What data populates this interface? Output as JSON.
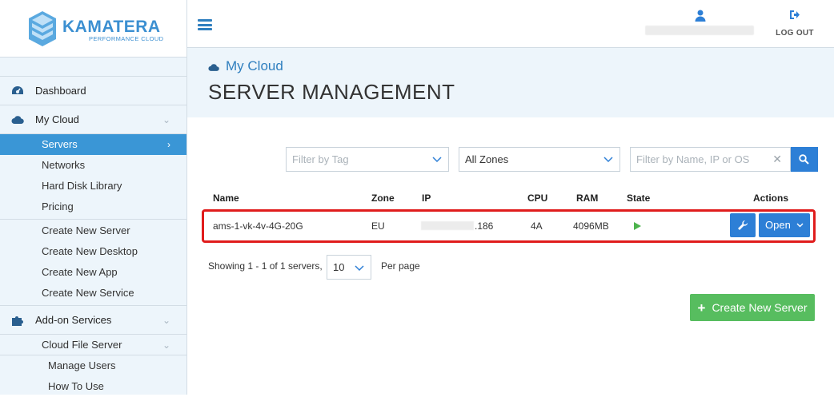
{
  "brand": {
    "name": "KAMATERA",
    "tagline": "PERFORMANCE CLOUD",
    "color": "#3b8fd1"
  },
  "sidebar": {
    "dashboard": "Dashboard",
    "my_cloud": "My Cloud",
    "my_cloud_items": [
      "Servers",
      "Networks",
      "Hard Disk Library",
      "Pricing"
    ],
    "create_items": [
      "Create New Server",
      "Create New Desktop",
      "Create New App",
      "Create New Service"
    ],
    "addon": "Add-on Services",
    "cloud_file_server": "Cloud File Server",
    "cfs_items": [
      "Manage Users",
      "How To Use"
    ]
  },
  "topbar": {
    "logout": "LOG OUT"
  },
  "header": {
    "breadcrumb": "My Cloud",
    "title": "SERVER MANAGEMENT"
  },
  "filters": {
    "tag_placeholder": "Filter by Tag",
    "zone_value": "All Zones",
    "search_placeholder": "Filter by Name, IP or OS"
  },
  "table": {
    "headers": {
      "name": "Name",
      "zone": "Zone",
      "ip": "IP",
      "cpu": "CPU",
      "ram": "RAM",
      "state": "State",
      "actions": "Actions"
    },
    "rows": [
      {
        "name": "ams-1-vk-4v-4G-20G",
        "zone": "EU",
        "ip_suffix": ".186",
        "cpu": "4A",
        "ram": "4096MB",
        "open": "Open"
      }
    ]
  },
  "pagination": {
    "showing": "Showing 1 - 1 of 1 servers,",
    "per_page_value": "10",
    "per_page_label": "Per page"
  },
  "actions": {
    "create_server": "Create New Server"
  },
  "colors": {
    "primary": "#2d7fd6",
    "active_nav": "#3a96d6",
    "success": "#57bd5f",
    "highlight": "#e01c1c"
  }
}
